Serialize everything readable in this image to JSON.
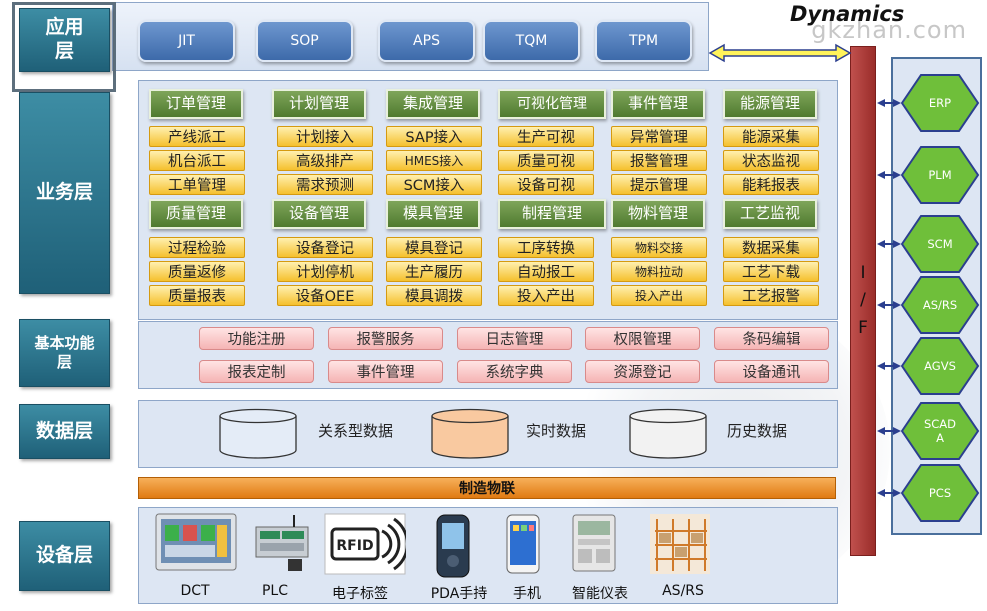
{
  "watermark": "gkzhan.com",
  "brand": "Dynamics",
  "layers": {
    "app": "应用层",
    "business": "业务层",
    "basic": "基本功能层",
    "data": "数据层",
    "device": "设备层"
  },
  "app_items": [
    "JIT",
    "SOP",
    "APS",
    "TQM",
    "TPM"
  ],
  "business_groups": [
    {
      "title": "订单管理",
      "items": [
        "产线派工",
        "机台派工",
        "工单管理"
      ]
    },
    {
      "title": "计划管理",
      "items": [
        "计划接入",
        "高级排产",
        "需求预测"
      ]
    },
    {
      "title": "集成管理",
      "items": [
        "SAP接入",
        "HMES接入",
        "SCM接入"
      ]
    },
    {
      "title": "可视化管理",
      "items": [
        "生产可视",
        "质量可视",
        "设备可视"
      ]
    },
    {
      "title": "事件管理",
      "items": [
        "异常管理",
        "报警管理",
        "提示管理"
      ]
    },
    {
      "title": "能源管理",
      "items": [
        "能源采集",
        "状态监视",
        "能耗报表"
      ]
    },
    {
      "title": "质量管理",
      "items": [
        "过程检验",
        "质量返修",
        "质量报表"
      ]
    },
    {
      "title": "设备管理",
      "items": [
        "设备登记",
        "计划停机",
        "设备OEE"
      ]
    },
    {
      "title": "模具管理",
      "items": [
        "模具登记",
        "生产履历",
        "模具调拨"
      ]
    },
    {
      "title": "制程管理",
      "items": [
        "工序转换",
        "自动报工",
        "投入产出"
      ]
    },
    {
      "title": "物料管理",
      "items": [
        "物料交接",
        "物料拉动",
        "投入产出"
      ]
    },
    {
      "title": "工艺监视",
      "items": [
        "数据采集",
        "工艺下载",
        "工艺报警"
      ]
    }
  ],
  "basic_functions": [
    "功能注册",
    "报警服务",
    "日志管理",
    "权限管理",
    "条码编辑",
    "报表定制",
    "事件管理",
    "系统字典",
    "资源登记",
    "设备通讯"
  ],
  "databases": [
    {
      "label": "关系型数据",
      "color": "#e4ecf7"
    },
    {
      "label": "实时数据",
      "color": "#f9c9a0"
    },
    {
      "label": "历史数据",
      "color": "#f2f2f2"
    }
  ],
  "iot_bar": "制造物联",
  "devices": [
    "DCT",
    "PLC",
    "电子标签",
    "PDA手持",
    "手机",
    "智能仪表",
    "AS/RS"
  ],
  "device_icons": [
    "touch-panel-icon",
    "plc-module-icon",
    "rfid-tag-icon",
    "pda-handheld-icon",
    "mobile-phone-icon",
    "smart-meter-icon",
    "warehouse-rack-icon"
  ],
  "rfid_text": "RFID",
  "interface": [
    "I",
    "/",
    "F"
  ],
  "external_systems": [
    "ERP",
    "PLM",
    "SCM",
    "AS/RS",
    "AGVS",
    "SCAD\nA",
    "PCS"
  ],
  "colors": {
    "layer_label": "#2a7189",
    "category": "#5f8b3c",
    "item": "#f7c53c",
    "function": "#f5b4b4",
    "iot": "#ee8a1f",
    "interface": "#b03c39",
    "hexagon": "#6fbf3a"
  }
}
